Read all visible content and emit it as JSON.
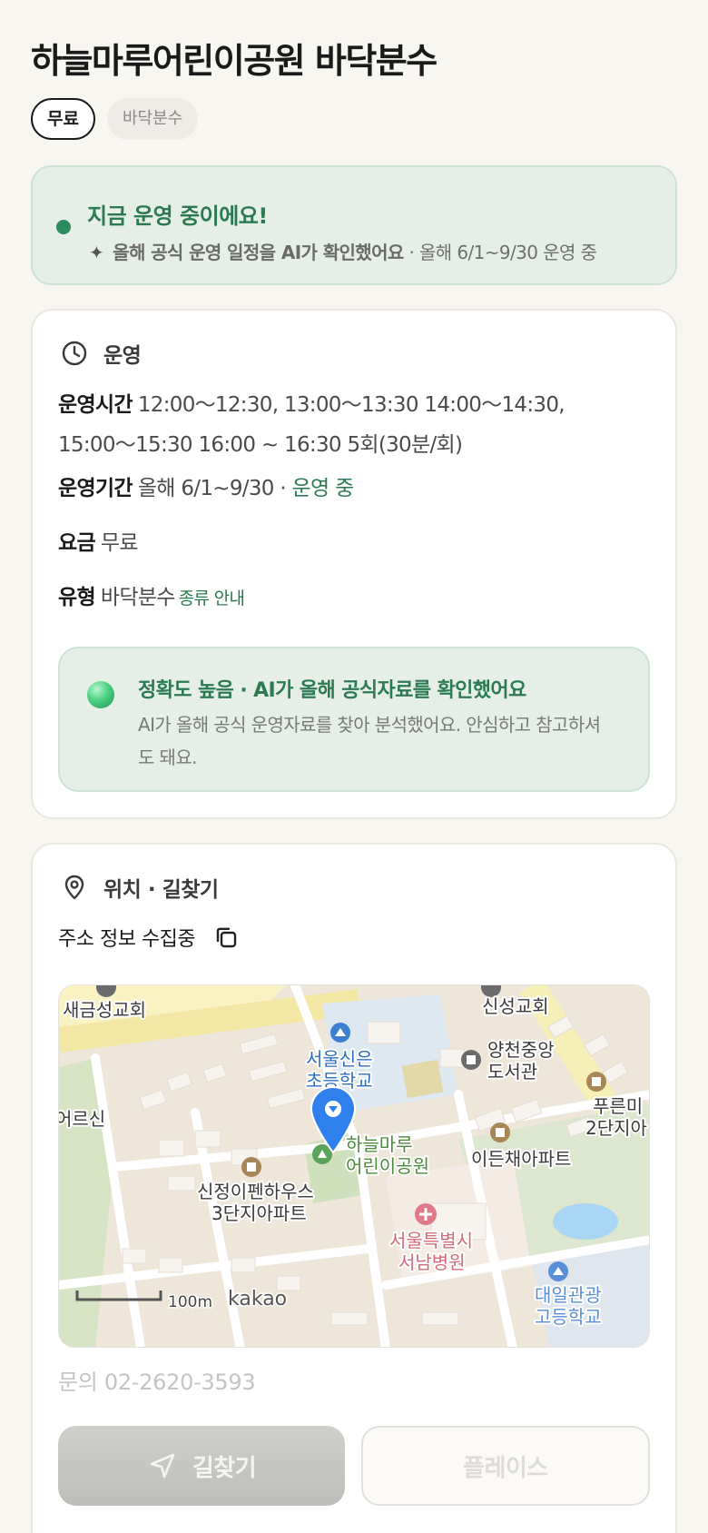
{
  "title": "하늘마루어린이공원 바닥분수",
  "chips": {
    "fee": "무료",
    "type": "바닥분수"
  },
  "status": {
    "title": "지금 운영 중이에요!",
    "spark_icon": "sparkle-icon",
    "ai_note": "올해 공식 운영 일정을 AI가 확인했어요",
    "period_note": " · 올해 6/1~9/30 운영 중"
  },
  "operation": {
    "section_label": "운영",
    "hours_key": "운영시간",
    "hours_line1": "12:00～12:30, 13:00～13:30 14:00～14:30,",
    "hours_line2": "15:00～15:30 16:00 ~ 16:30 5회(30분/회)",
    "period_key": "운영기간",
    "period_value": "올해 6/1~9/30 · ",
    "period_status": "운영 중",
    "fee_key": "요금",
    "fee_value": "무료",
    "type_key": "유형",
    "type_value": "바닥분수",
    "type_link": "종류 안내",
    "accuracy_title": "정확도 높음 · AI가 올해 공식자료를 확인했어요",
    "accuracy_desc": "AI가 올해 공식 운영자료를 찾아 분석했어요. 안심하고 참고하셔도 돼요."
  },
  "location": {
    "section_label": "위치 · 길찾기",
    "address": "주소 정보 수집중",
    "map_labels": {
      "church1": "새금성교회",
      "church2": "신성교회",
      "school1a": "서울신은",
      "school1b": "초등학교",
      "library_a": "양천중앙",
      "library_b": "도서관",
      "left": "어르신",
      "right_a": "푸른미",
      "right_b": "2단지아",
      "park_a": "하늘마루",
      "park_b": "어린이공원",
      "apt1": "이든채아파트",
      "apt2a": "신정이펜하우스",
      "apt2b": "3단지아파트",
      "hosp_a": "서울특별시",
      "hosp_b": "서남병원",
      "school2a": "대일관광",
      "school2b": "고등학교",
      "scale": "100m",
      "brand": "kakao"
    },
    "phone": "문의 02-2620-3593",
    "route_button": "길찾기",
    "place_button": "플레이스"
  },
  "colors": {
    "accent_green": "#2b7a52",
    "status_bg": "#e5efe8",
    "map_pin": "#2f80ed"
  }
}
